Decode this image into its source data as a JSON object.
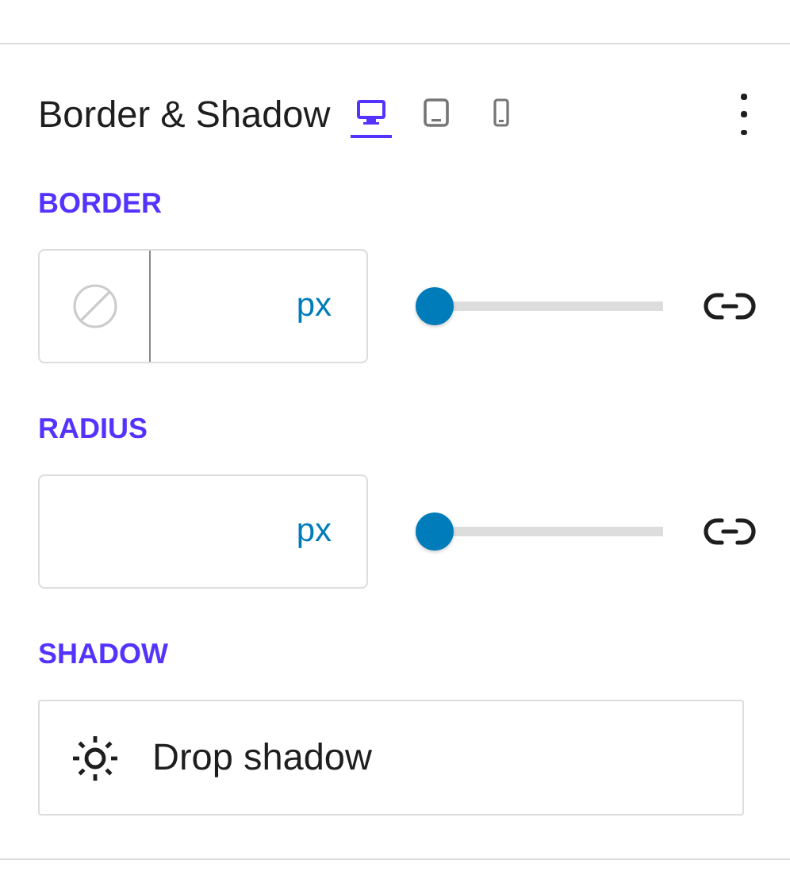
{
  "panel": {
    "title": "Border & Shadow"
  },
  "devices": [
    {
      "kind": "desktop",
      "selected": true
    },
    {
      "kind": "tablet",
      "selected": false
    },
    {
      "kind": "mobile",
      "selected": false
    }
  ],
  "sections": [
    {
      "kind": "unit",
      "label": "BORDER",
      "has_style": true,
      "unit": "px",
      "level": 0
    },
    {
      "kind": "unit",
      "label": "RADIUS",
      "has_style": false,
      "unit": "px",
      "level": 0
    },
    {
      "kind": "shadow",
      "label": "SHADOW",
      "button": "Drop shadow"
    }
  ]
}
